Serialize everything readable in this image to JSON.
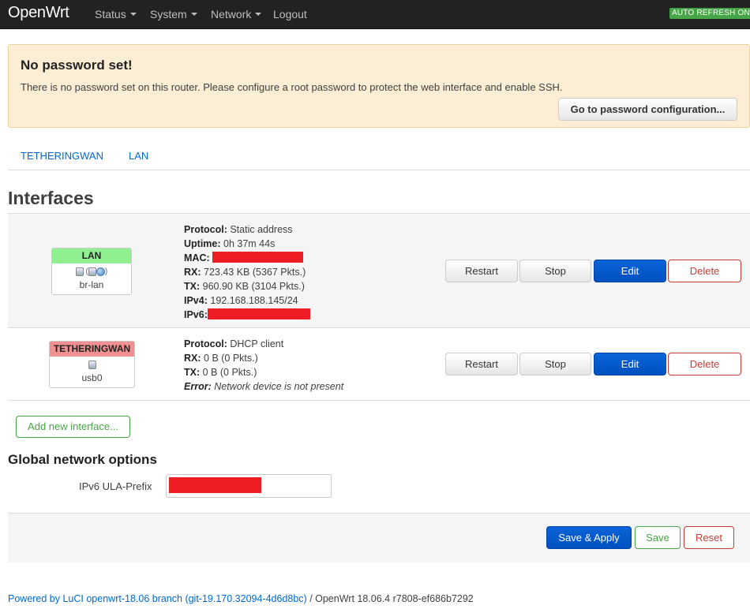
{
  "navbar": {
    "brand": "OpenWrt",
    "menu": [
      "Status",
      "System",
      "Network",
      "Logout"
    ],
    "auto_refresh": "AUTO REFRESH ON"
  },
  "alert": {
    "title": "No password set!",
    "text": "There is no password set on this router. Please configure a root password to protect the web interface and enable SSH.",
    "button": "Go to password configuration..."
  },
  "tabs": [
    "TETHERINGWAN",
    "LAN"
  ],
  "interfaces": {
    "title": "Interfaces",
    "rows": [
      {
        "name": "LAN",
        "name_color": "#90f090",
        "device": "br-lan",
        "lines": [
          {
            "label": "Protocol:",
            "value": "Static address"
          },
          {
            "label": "Uptime:",
            "value": "0h 37m 44s"
          },
          {
            "label": "MAC:",
            "value": ""
          },
          {
            "label": "RX:",
            "value": "723.43 KB (5367 Pkts.)"
          },
          {
            "label": "TX:",
            "value": "960.90 KB (3104 Pkts.)"
          },
          {
            "label": "IPv4:",
            "value": "192.168.188.145/24"
          },
          {
            "label": "IPv6:",
            "value": ""
          }
        ]
      },
      {
        "name": "TETHERINGWAN",
        "name_color": "#f09090",
        "device": "usb0",
        "lines": [
          {
            "label": "Protocol:",
            "value": "DHCP client"
          },
          {
            "label": "RX:",
            "value": "0 B (0 Pkts.)"
          },
          {
            "label": "TX:",
            "value": "0 B (0 Pkts.)"
          },
          {
            "label": "Error:",
            "value": "Network device is not present"
          }
        ]
      }
    ],
    "buttons": {
      "restart": "Restart",
      "stop": "Stop",
      "edit": "Edit",
      "delete": "Delete"
    },
    "add_button": "Add new interface..."
  },
  "global": {
    "title": "Global network options",
    "ula_label": "IPv6 ULA-Prefix",
    "ula_value": ""
  },
  "actions": {
    "save_apply": "Save & Apply",
    "save": "Save",
    "reset": "Reset"
  },
  "footer": {
    "link": "Powered by LuCI openwrt-18.06 branch (git-19.170.32094-4d6d8bc)",
    "suffix": " / OpenWrt 18.06.4 r7808-ef686b7292"
  },
  "colors": {
    "redacted": "#ee1c24",
    "primary": "#0055cc",
    "success": "#46a546",
    "danger": "#c43c35"
  }
}
